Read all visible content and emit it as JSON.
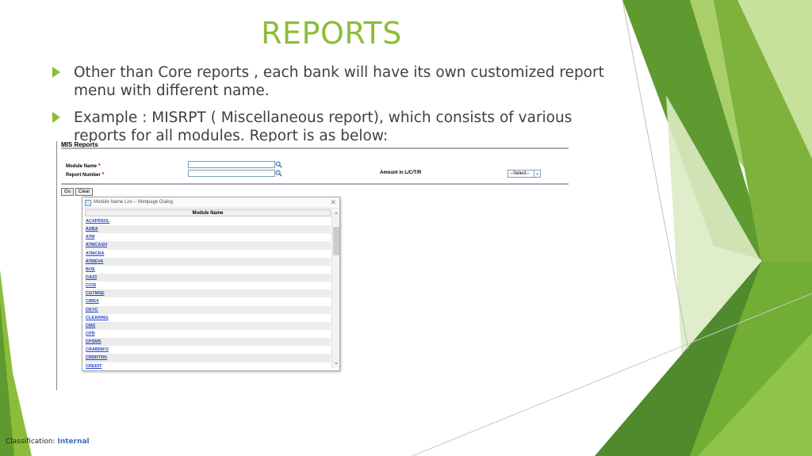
{
  "slide": {
    "title": "REPORTS",
    "bullets": [
      "Other than Core reports , each bank will have its own customized report menu with different name.",
      "Example : MISRPT ( Miscellaneous report), which consists of various reports for all modules. Report is as below:"
    ],
    "classification_label": "Classification:",
    "classification_value": "Internal",
    "colors": {
      "accent": "#8cbd3a",
      "dark_green": "#4f8a2c",
      "light_green": "#c8dea0"
    }
  },
  "screenshot": {
    "heading": "MIS Reports",
    "fields": {
      "module_name_label": "Module Name",
      "report_number_label": "Report Number",
      "required_mark": "*",
      "module_name_value": "",
      "report_number_value": "",
      "amount_label": "Amount in L/C/T/R",
      "amount_select_value": "--Select--"
    },
    "buttons": {
      "go": "Go",
      "clear": "Clear"
    },
    "dialog": {
      "title": "Module Name List -- Webpage Dialog",
      "column_header": "Module Name",
      "modules": [
        "ACXFRSOL",
        "ASBA",
        "ATM",
        "ATMCASH",
        "ATMCRA",
        "ATMEVA",
        "BOE",
        "CA23",
        "CCIS",
        "CGTMSE",
        "CIBEX",
        "CKYC",
        "CLEARING",
        "CMS",
        "CPD",
        "CPSMS",
        "CRABINFO",
        "CRDRTRK",
        "CREDIT"
      ]
    }
  }
}
